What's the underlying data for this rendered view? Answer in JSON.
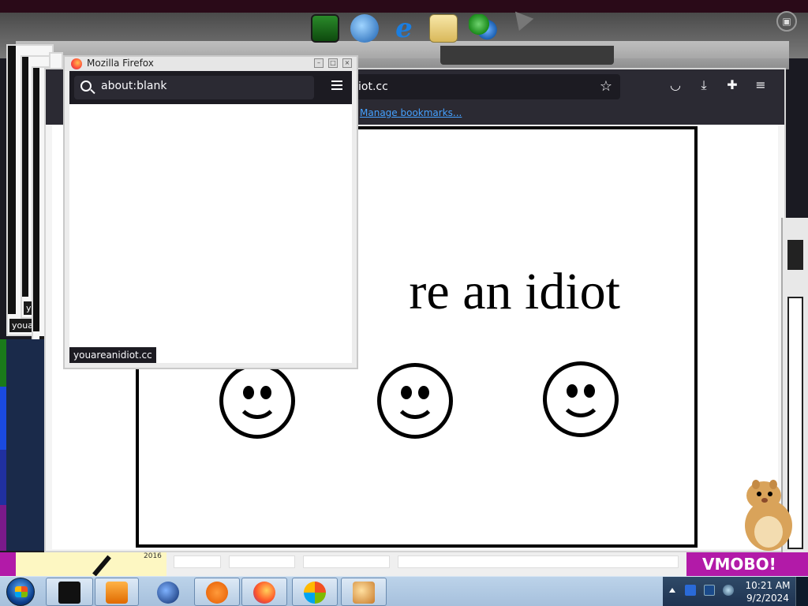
{
  "popup_window": {
    "title": "Mozilla Firefox",
    "url": "about:blank",
    "status_text": "youareanidiot.cc"
  },
  "main_window": {
    "url_partial": "iot.cc",
    "bookmarks_link": "Manage bookmarks...",
    "page_text": "re an idiot",
    "smiley_count": 3
  },
  "ghost_windows": {
    "captions": [
      "youar",
      "you",
      "you",
      "youa"
    ]
  },
  "bottom_strip": {
    "year": "2016"
  },
  "purple_text": "VMOBO!",
  "taskbar": {
    "time": "10:21 AM",
    "date": "9/2/2024",
    "buttons": [
      "terminal-app",
      "media-player",
      "globe-app",
      "avast-antivirus",
      "firefox",
      "windows-media-center",
      "paint-app"
    ]
  },
  "top_icons": [
    "spreadsheet-icon",
    "network-globe-icon",
    "internet-explorer-icon",
    "mail-icon",
    "messenger-icon"
  ],
  "colors": {
    "firefox_dark": "#2b2a33",
    "taskbar": "#a6c0dc",
    "link": "#45a1ff",
    "purple": "#b21aa8"
  }
}
